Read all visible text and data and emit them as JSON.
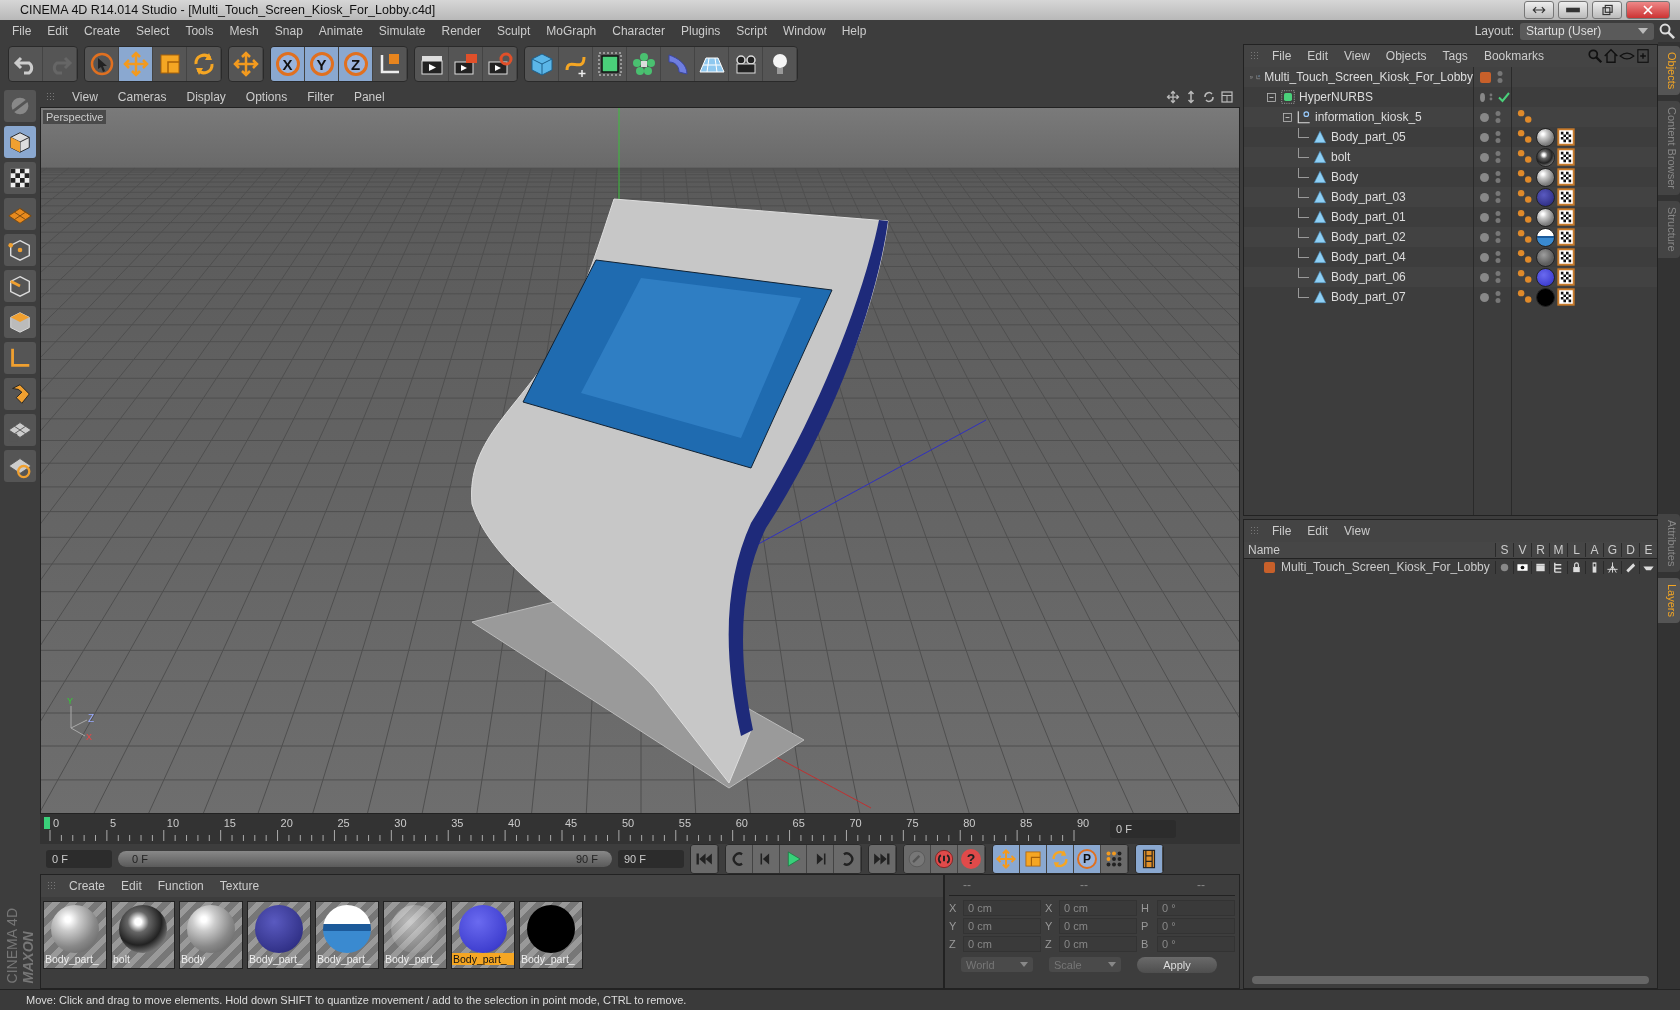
{
  "window": {
    "title": "CINEMA 4D R14.014 Studio - [Multi_Touch_Screen_Kiosk_For_Lobby.c4d]"
  },
  "menu": [
    "File",
    "Edit",
    "Create",
    "Select",
    "Tools",
    "Mesh",
    "Snap",
    "Animate",
    "Simulate",
    "Render",
    "Sculpt",
    "MoGraph",
    "Character",
    "Plugins",
    "Script",
    "Window",
    "Help"
  ],
  "layout": {
    "label": "Layout:",
    "value": "Startup (User)"
  },
  "toolbar": [
    [
      {
        "selected": false
      },
      {
        "selected": false
      }
    ],
    [
      {
        "selected": false
      },
      {
        "selected": true
      },
      {
        "selected": false
      },
      {
        "selected": false
      }
    ],
    [
      {
        "selected": false
      }
    ],
    [
      {
        "label": "X",
        "selected": true
      },
      {
        "label": "Y",
        "selected": true
      },
      {
        "label": "Z",
        "selected": true
      },
      {
        "selected": false
      }
    ],
    [
      {
        "selected": false
      },
      {
        "selected": false
      },
      {
        "selected": false
      }
    ],
    [
      {
        "selected": false
      },
      {
        "selected": false
      },
      {
        "selected": false
      },
      {
        "selected": false
      },
      {
        "selected": false
      },
      {
        "selected": false
      },
      {
        "selected": false
      },
      {
        "selected": false
      }
    ]
  ],
  "left_tools": [
    {
      "selected": false
    },
    {
      "selected": true
    },
    {
      "selected": false
    },
    {
      "selected": false
    },
    {
      "selected": false
    },
    {
      "selected": false
    },
    {
      "selected": false
    },
    {
      "selected": false
    },
    {
      "selected": false
    },
    {
      "selected": false
    },
    {
      "selected": false
    }
  ],
  "brand": {
    "company": "MAXON",
    "product": "CINEMA 4D"
  },
  "viewport": {
    "menu": [
      "View",
      "Cameras",
      "Display",
      "Options",
      "Filter",
      "Panel"
    ],
    "camera_label": "Perspective",
    "axis_labels": [
      "Y",
      "Z",
      "X"
    ]
  },
  "objects_panel": {
    "menu": [
      "File",
      "Edit",
      "View",
      "Objects",
      "Tags",
      "Bookmarks"
    ],
    "tree": [
      {
        "name": "Multi_Touch_Screen_Kiosk_For_Lobby",
        "kind": "null",
        "color": "#c8602a",
        "children": [
          {
            "name": "HyperNURBS",
            "kind": "nurbs",
            "enabled": true,
            "children": [
              {
                "name": "information_kiosk_5",
                "kind": "null",
                "tags": [
                  {
                    "kind": "phong"
                  }
                ],
                "children": [
                  {
                    "name": "Body_part_05",
                    "kind": "mesh",
                    "tags": [
                      {
                        "kind": "phong"
                      },
                      {
                        "kind": "matte"
                      },
                      {
                        "kind": "uvw"
                      }
                    ]
                  },
                  {
                    "name": "bolt",
                    "kind": "mesh",
                    "tags": [
                      {
                        "kind": "phong"
                      },
                      {
                        "kind": "chrome"
                      },
                      {
                        "kind": "uvw"
                      }
                    ]
                  },
                  {
                    "name": "Body",
                    "kind": "mesh",
                    "tags": [
                      {
                        "kind": "phong"
                      },
                      {
                        "kind": "matte"
                      },
                      {
                        "kind": "uvw"
                      }
                    ]
                  },
                  {
                    "name": "Body_part_03",
                    "kind": "mesh",
                    "tags": [
                      {
                        "kind": "phong"
                      },
                      {
                        "kind": "navy"
                      },
                      {
                        "kind": "uvw"
                      }
                    ]
                  },
                  {
                    "name": "Body_part_01",
                    "kind": "mesh",
                    "tags": [
                      {
                        "kind": "phong"
                      },
                      {
                        "kind": "matte"
                      },
                      {
                        "kind": "uvw"
                      }
                    ]
                  },
                  {
                    "name": "Body_part_02",
                    "kind": "mesh",
                    "tags": [
                      {
                        "kind": "phong"
                      },
                      {
                        "kind": "screen"
                      },
                      {
                        "kind": "uvw"
                      }
                    ]
                  },
                  {
                    "name": "Body_part_04",
                    "kind": "mesh",
                    "tags": [
                      {
                        "kind": "phong"
                      },
                      {
                        "kind": "glass"
                      },
                      {
                        "kind": "uvw"
                      }
                    ]
                  },
                  {
                    "name": "Body_part_06",
                    "kind": "mesh",
                    "tags": [
                      {
                        "kind": "phong"
                      },
                      {
                        "kind": "glossy"
                      },
                      {
                        "kind": "uvw"
                      }
                    ]
                  },
                  {
                    "name": "Body_part_07",
                    "kind": "mesh",
                    "tags": [
                      {
                        "kind": "phong"
                      },
                      {
                        "kind": "ink"
                      },
                      {
                        "kind": "uvw"
                      }
                    ]
                  }
                ]
              }
            ]
          }
        ]
      }
    ]
  },
  "side_tabs_top": [
    {
      "label": "Objects",
      "selected": true
    },
    {
      "label": "Content Browser",
      "selected": false
    },
    {
      "label": "Structure",
      "selected": false
    }
  ],
  "side_tabs_bottom": [
    {
      "label": "Attributes",
      "selected": false
    },
    {
      "label": "Layers",
      "selected": true
    }
  ],
  "layers_panel": {
    "menu": [
      "File",
      "Edit",
      "View"
    ],
    "columns": [
      "Name",
      "S",
      "V",
      "R",
      "M",
      "L",
      "A",
      "G",
      "D",
      "E"
    ],
    "rows": [
      {
        "name": "Multi_Touch_Screen_Kiosk_For_Lobby",
        "color": "#c8602a"
      }
    ]
  },
  "timeline": {
    "ticks": [
      "0",
      "5",
      "10",
      "15",
      "20",
      "25",
      "30",
      "35",
      "40",
      "45",
      "50",
      "55",
      "60",
      "65",
      "70",
      "75",
      "80",
      "85",
      "90"
    ],
    "current_frame": "0 F",
    "start": "0 F",
    "range": {
      "start": "0 F",
      "end": "90 F",
      "level": 1
    },
    "end": "90 F"
  },
  "key_tools": [
    {
      "selected": true
    },
    {
      "selected": true
    },
    {
      "selected": true
    },
    {
      "label": "P",
      "selected": true
    },
    {
      "selected": false
    }
  ],
  "record_tools": [
    {
      "kind": "keys"
    },
    {
      "kind": "record"
    },
    {
      "kind": "help",
      "label": "?"
    }
  ],
  "materials": {
    "menu": [
      "Create",
      "Edit",
      "Function",
      "Texture"
    ],
    "items": [
      {
        "name": "Body_part_",
        "kind": "matte",
        "selected": false
      },
      {
        "name": "bolt",
        "kind": "chrome",
        "selected": false
      },
      {
        "name": "Body",
        "kind": "matte",
        "selected": false
      },
      {
        "name": "Body_part_",
        "kind": "navy",
        "selected": false
      },
      {
        "name": "Body_part_",
        "kind": "screen",
        "selected": false
      },
      {
        "name": "Body_part_",
        "kind": "glass",
        "selected": false
      },
      {
        "name": "Body_part_",
        "kind": "glossy",
        "selected": true
      },
      {
        "name": "Body_part_",
        "kind": "ink",
        "selected": false
      }
    ]
  },
  "coordinates": {
    "headers": [
      "--",
      "--",
      "--"
    ],
    "rows": [
      {
        "labels": [
          "X",
          "X",
          "H"
        ],
        "values": [
          "0 cm",
          "0 cm",
          "0 °"
        ]
      },
      {
        "labels": [
          "Y",
          "Y",
          "P"
        ],
        "values": [
          "0 cm",
          "0 cm",
          "0 °"
        ]
      },
      {
        "labels": [
          "Z",
          "Z",
          "B"
        ],
        "values": [
          "0 cm",
          "0 cm",
          "0 °"
        ]
      }
    ],
    "dropdowns": [
      "World",
      "Scale"
    ],
    "apply": "Apply"
  },
  "status_bar": "Move: Click and drag to move elements. Hold down SHIFT to quantize movement / add to the selection in point mode, CTRL to remove."
}
